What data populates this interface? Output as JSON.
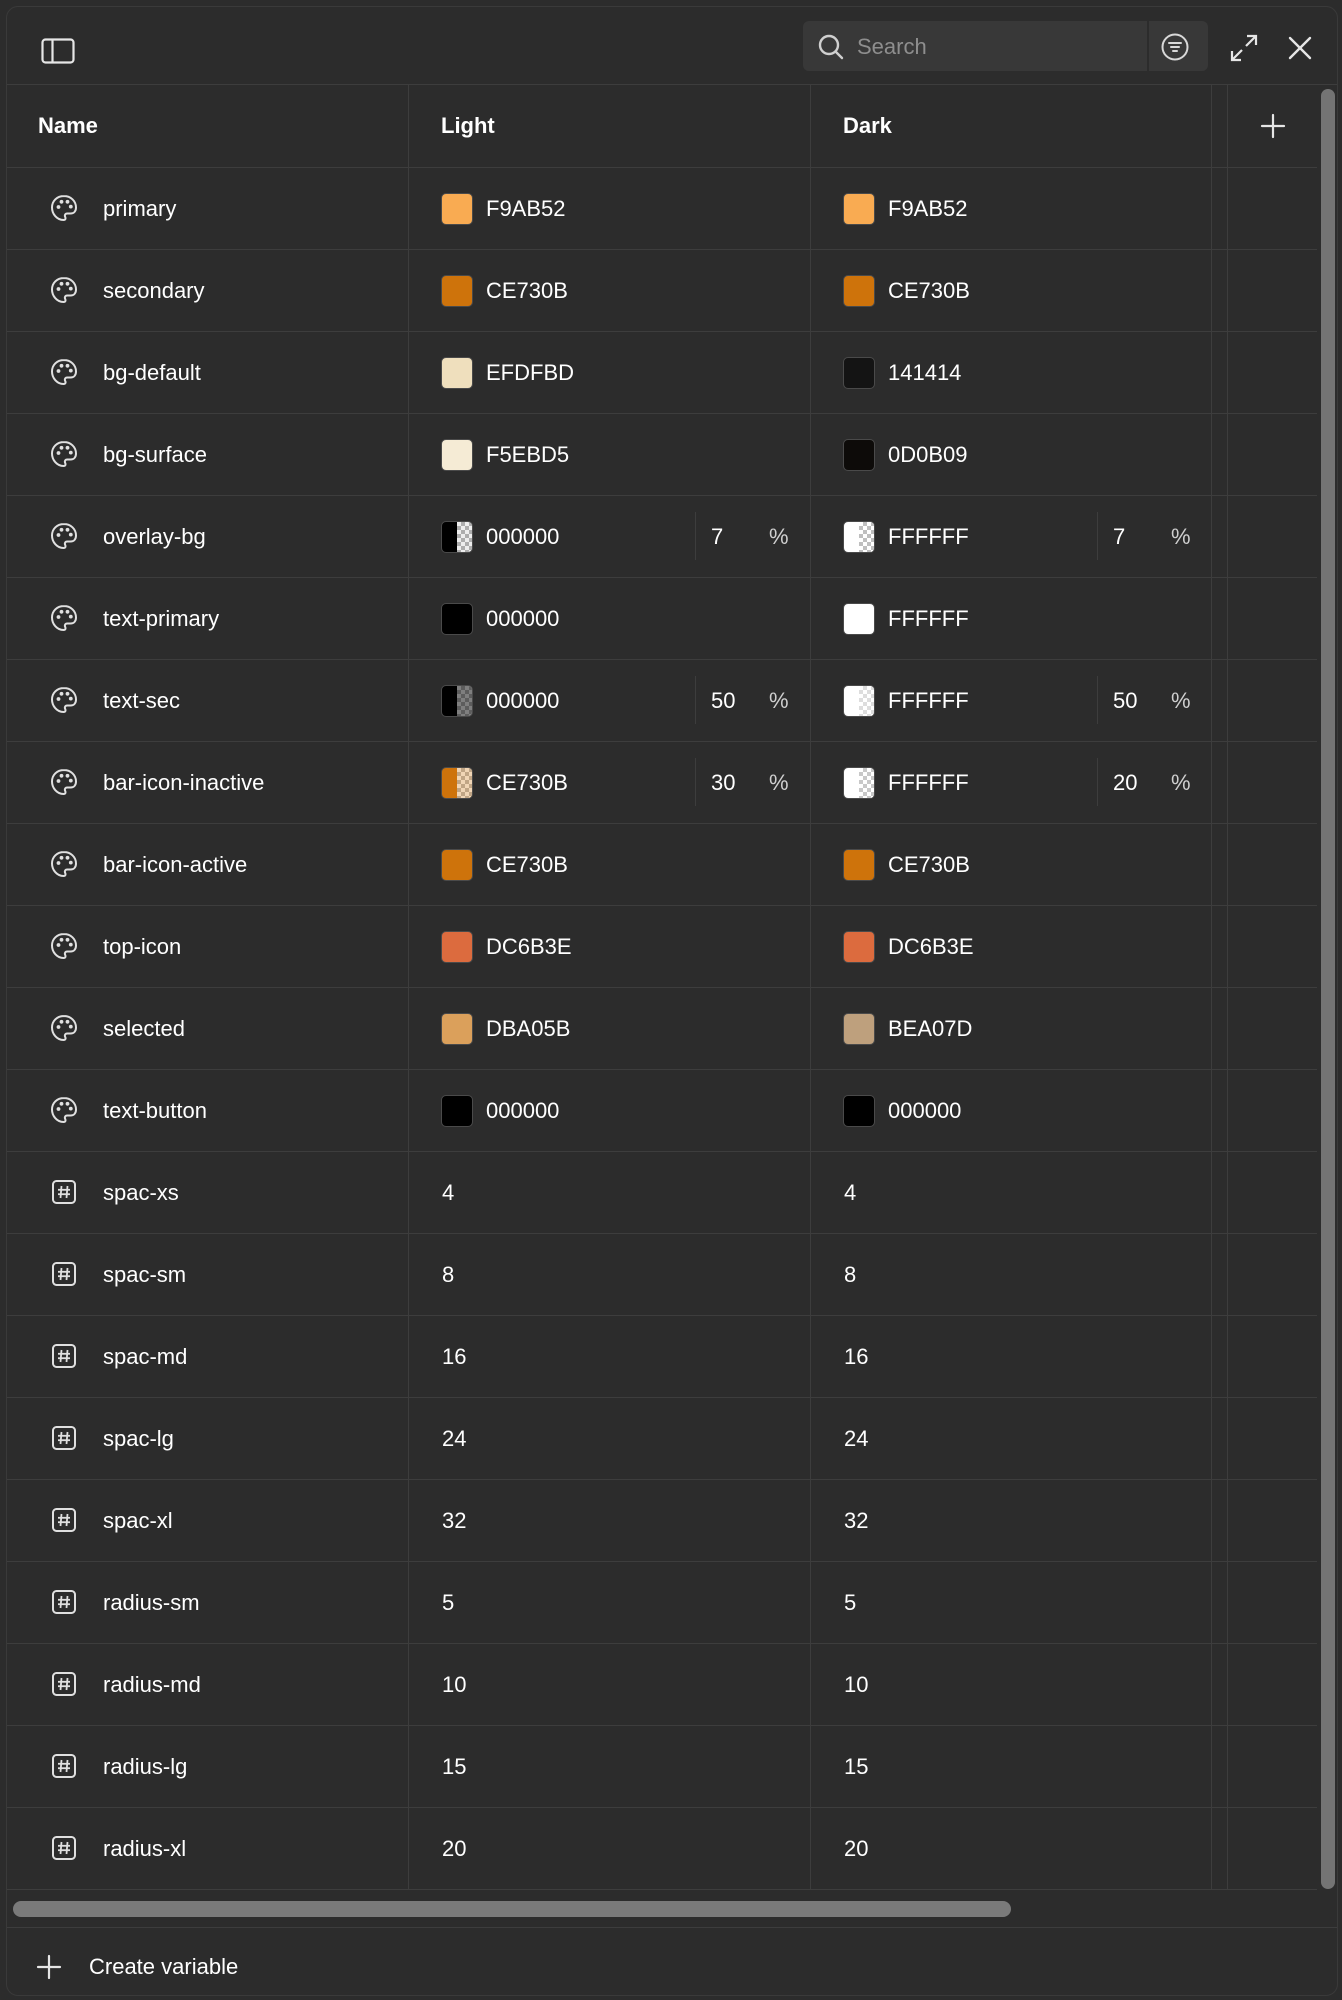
{
  "toolbar": {
    "search_placeholder": "Search"
  },
  "table": {
    "headers": {
      "name": "Name",
      "light": "Light",
      "dark": "Dark"
    },
    "rows": [
      {
        "type": "color",
        "name": "primary",
        "light": {
          "hex": "F9AB52",
          "color": "#F9AB52"
        },
        "dark": {
          "hex": "F9AB52",
          "color": "#F9AB52"
        }
      },
      {
        "type": "color",
        "name": "secondary",
        "light": {
          "hex": "CE730B",
          "color": "#CE730B"
        },
        "dark": {
          "hex": "CE730B",
          "color": "#CE730B"
        }
      },
      {
        "type": "color",
        "name": "bg-default",
        "light": {
          "hex": "EFDFBD",
          "color": "#EFDFBD"
        },
        "dark": {
          "hex": "141414",
          "color": "#141414"
        }
      },
      {
        "type": "color",
        "name": "bg-surface",
        "light": {
          "hex": "F5EBD5",
          "color": "#F5EBD5"
        },
        "dark": {
          "hex": "0D0B09",
          "color": "#0D0B09"
        }
      },
      {
        "type": "color",
        "name": "overlay-bg",
        "light": {
          "hex": "000000",
          "color": "#000000",
          "alpha": "7",
          "pct": "%"
        },
        "dark": {
          "hex": "FFFFFF",
          "color": "#FFFFFF",
          "alpha": "7",
          "pct": "%"
        }
      },
      {
        "type": "color",
        "name": "text-primary",
        "light": {
          "hex": "000000",
          "color": "#000000"
        },
        "dark": {
          "hex": "FFFFFF",
          "color": "#FFFFFF"
        }
      },
      {
        "type": "color",
        "name": "text-sec",
        "light": {
          "hex": "000000",
          "color": "#000000",
          "alpha": "50",
          "pct": "%"
        },
        "dark": {
          "hex": "FFFFFF",
          "color": "#FFFFFF",
          "alpha": "50",
          "pct": "%"
        }
      },
      {
        "type": "color",
        "name": "bar-icon-inactive",
        "light": {
          "hex": "CE730B",
          "color": "#CE730B",
          "alpha": "30",
          "pct": "%"
        },
        "dark": {
          "hex": "FFFFFF",
          "color": "#FFFFFF",
          "alpha": "20",
          "pct": "%"
        }
      },
      {
        "type": "color",
        "name": "bar-icon-active",
        "light": {
          "hex": "CE730B",
          "color": "#CE730B"
        },
        "dark": {
          "hex": "CE730B",
          "color": "#CE730B"
        }
      },
      {
        "type": "color",
        "name": "top-icon",
        "light": {
          "hex": "DC6B3E",
          "color": "#DC6B3E"
        },
        "dark": {
          "hex": "DC6B3E",
          "color": "#DC6B3E"
        }
      },
      {
        "type": "color",
        "name": "selected",
        "light": {
          "hex": "DBA05B",
          "color": "#DBA05B"
        },
        "dark": {
          "hex": "BEA07D",
          "color": "#BEA07D"
        }
      },
      {
        "type": "color",
        "name": "text-button",
        "light": {
          "hex": "000000",
          "color": "#000000"
        },
        "dark": {
          "hex": "000000",
          "color": "#000000"
        }
      },
      {
        "type": "number",
        "name": "spac-xs",
        "light": {
          "value": "4"
        },
        "dark": {
          "value": "4"
        }
      },
      {
        "type": "number",
        "name": "spac-sm",
        "light": {
          "value": "8"
        },
        "dark": {
          "value": "8"
        }
      },
      {
        "type": "number",
        "name": "spac-md",
        "light": {
          "value": "16"
        },
        "dark": {
          "value": "16"
        }
      },
      {
        "type": "number",
        "name": "spac-lg",
        "light": {
          "value": "24"
        },
        "dark": {
          "value": "24"
        }
      },
      {
        "type": "number",
        "name": "spac-xl",
        "light": {
          "value": "32"
        },
        "dark": {
          "value": "32"
        }
      },
      {
        "type": "number",
        "name": "radius-sm",
        "light": {
          "value": "5"
        },
        "dark": {
          "value": "5"
        }
      },
      {
        "type": "number",
        "name": "radius-md",
        "light": {
          "value": "10"
        },
        "dark": {
          "value": "10"
        }
      },
      {
        "type": "number",
        "name": "radius-lg",
        "light": {
          "value": "15"
        },
        "dark": {
          "value": "15"
        }
      },
      {
        "type": "number",
        "name": "radius-xl",
        "light": {
          "value": "20"
        },
        "dark": {
          "value": "20"
        }
      }
    ]
  },
  "footer": {
    "create_label": "Create variable"
  },
  "icons": {
    "color_type": "palette-icon",
    "number_type": "hash-icon"
  },
  "colors": {
    "background": "#2c2c2c",
    "border": "#3d3d3d",
    "search_bg": "#383838",
    "scrollbar": "#7a7a7a"
  }
}
